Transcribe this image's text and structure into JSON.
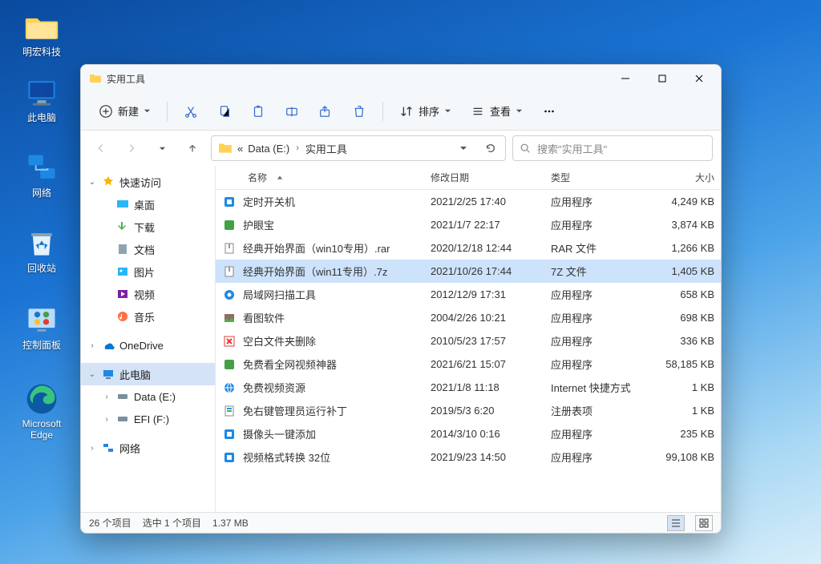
{
  "desktop": {
    "icons": [
      {
        "label": "明宏科技",
        "type": "folder"
      },
      {
        "label": "此电脑",
        "type": "pc"
      },
      {
        "label": "网络",
        "type": "network"
      },
      {
        "label": "回收站",
        "type": "recycle"
      },
      {
        "label": "控制面板",
        "type": "control"
      },
      {
        "label": "Microsoft Edge",
        "type": "edge"
      }
    ]
  },
  "window": {
    "title": "实用工具",
    "toolbar": {
      "new_label": "新建",
      "sort_label": "排序",
      "view_label": "查看"
    },
    "address": {
      "prefix": "«",
      "crumb1": "Data (E:)",
      "crumb2": "实用工具"
    },
    "search": {
      "placeholder": "搜索\"实用工具\""
    },
    "sidebar": {
      "quick": "快速访问",
      "desktop": "桌面",
      "downloads": "下载",
      "documents": "文档",
      "pictures": "图片",
      "videos": "视频",
      "music": "音乐",
      "onedrive": "OneDrive",
      "thispc": "此电脑",
      "data": "Data (E:)",
      "efi": "EFI (F:)",
      "network": "网络"
    },
    "columns": {
      "name": "名称",
      "date": "修改日期",
      "type": "类型",
      "size": "大小"
    },
    "files": [
      {
        "name": "定时开关机",
        "date": "2021/2/25 17:40",
        "type": "应用程序",
        "size": "4,249 KB",
        "icon": "app"
      },
      {
        "name": "护眼宝",
        "date": "2021/1/7 22:17",
        "type": "应用程序",
        "size": "3,874 KB",
        "icon": "app-green"
      },
      {
        "name": "经典开始界面（win10专用）.rar",
        "date": "2020/12/18 12:44",
        "type": "RAR 文件",
        "size": "1,266 KB",
        "icon": "archive"
      },
      {
        "name": "经典开始界面（win11专用）.7z",
        "date": "2021/10/26 17:44",
        "type": "7Z 文件",
        "size": "1,405 KB",
        "icon": "archive",
        "selected": true
      },
      {
        "name": "局域网扫描工具",
        "date": "2012/12/9 17:31",
        "type": "应用程序",
        "size": "658 KB",
        "icon": "scan"
      },
      {
        "name": "看图软件",
        "date": "2004/2/26 10:21",
        "type": "应用程序",
        "size": "698 KB",
        "icon": "img"
      },
      {
        "name": "空白文件夹删除",
        "date": "2010/5/23 17:57",
        "type": "应用程序",
        "size": "336 KB",
        "icon": "x"
      },
      {
        "name": "免费看全网视频神器",
        "date": "2021/6/21 15:07",
        "type": "应用程序",
        "size": "58,185 KB",
        "icon": "app-green"
      },
      {
        "name": "免费视频资源",
        "date": "2021/1/8 11:18",
        "type": "Internet 快捷方式",
        "size": "1 KB",
        "icon": "url"
      },
      {
        "name": "免右键管理员运行补丁",
        "date": "2019/5/3 6:20",
        "type": "注册表项",
        "size": "1 KB",
        "icon": "reg"
      },
      {
        "name": "摄像头一键添加",
        "date": "2014/3/10 0:16",
        "type": "应用程序",
        "size": "235 KB",
        "icon": "app"
      },
      {
        "name": "视频格式转换 32位",
        "date": "2021/9/23 14:50",
        "type": "应用程序",
        "size": "99,108 KB",
        "icon": "app"
      }
    ],
    "status": {
      "count": "26 个项目",
      "selection": "选中 1 个项目",
      "sel_size": "1.37 MB"
    }
  }
}
